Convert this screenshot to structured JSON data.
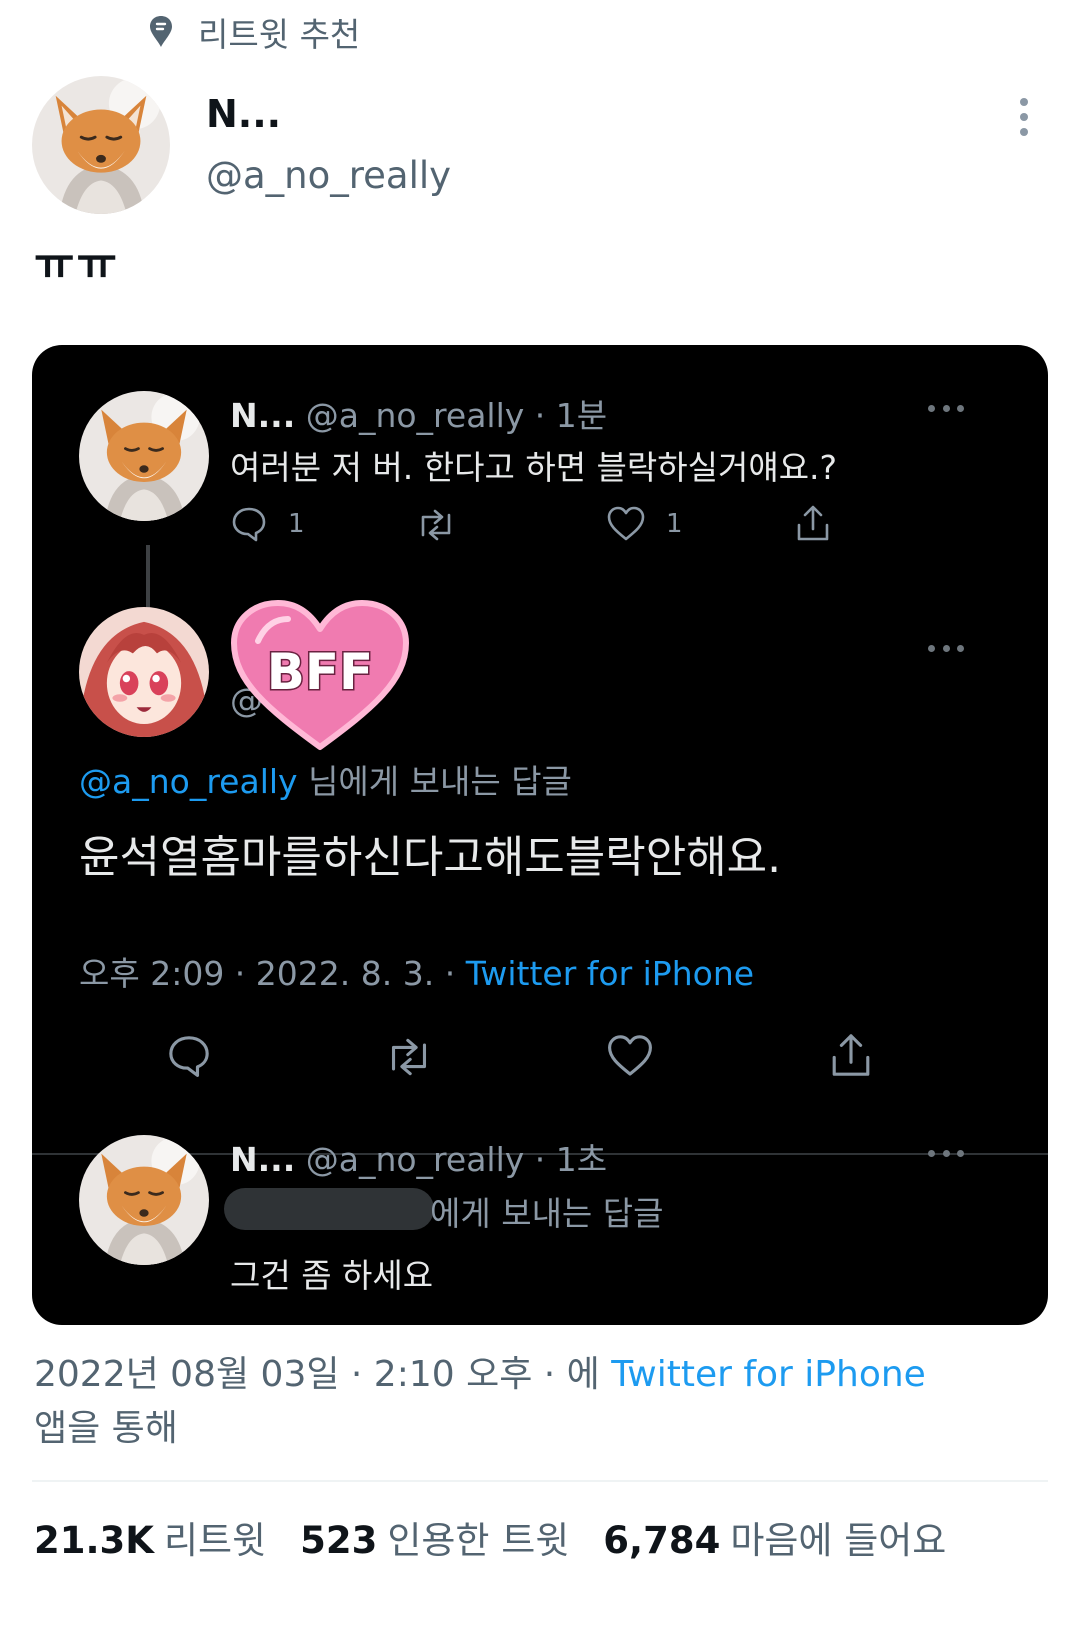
{
  "header": {
    "recommend_label": "리트윗 추천"
  },
  "tweet": {
    "author_name": "N...",
    "author_handle": "@a_no_really",
    "text": "ㅠㅠ",
    "timestamp": "2022년 08월 03일 · 2:10 오후 · 에",
    "source": "Twitter for iPhone",
    "source_suffix": "앱을 통해"
  },
  "stats": {
    "retweets_count": "21.3K",
    "retweets_label": "리트윗",
    "quotes_count": "523",
    "quotes_label": "인용한 트윗",
    "likes_count": "6,784",
    "likes_label": "마음에 들어요"
  },
  "screenshot": {
    "first": {
      "name": "N...",
      "meta": "@a_no_really · 1분",
      "text": "여러분 저 버. 한다고 하면 블락하실거얘요.?",
      "reply_count": "1",
      "like_count": "1"
    },
    "reply": {
      "sticker": "BFF",
      "partial_handle": "@",
      "reply_to_handle": "@a_no_really",
      "reply_to_suffix": "님에게 보내는 답글",
      "text": "윤석열홈마를하신다고해도블락안해요.",
      "time": "오후 2:09 · 2022. 8. 3. ·",
      "source": "Twitter for iPhone"
    },
    "last": {
      "name": "N...",
      "meta": "@a_no_really · 1초",
      "reply_suffix": "에게 보내는 답글",
      "text": "그건 좀 하세요"
    }
  },
  "colors": {
    "accent": "#1d9bf0",
    "dark_bg": "#000000",
    "muted": "#536471",
    "sticker_pink": "#f06fa8"
  }
}
